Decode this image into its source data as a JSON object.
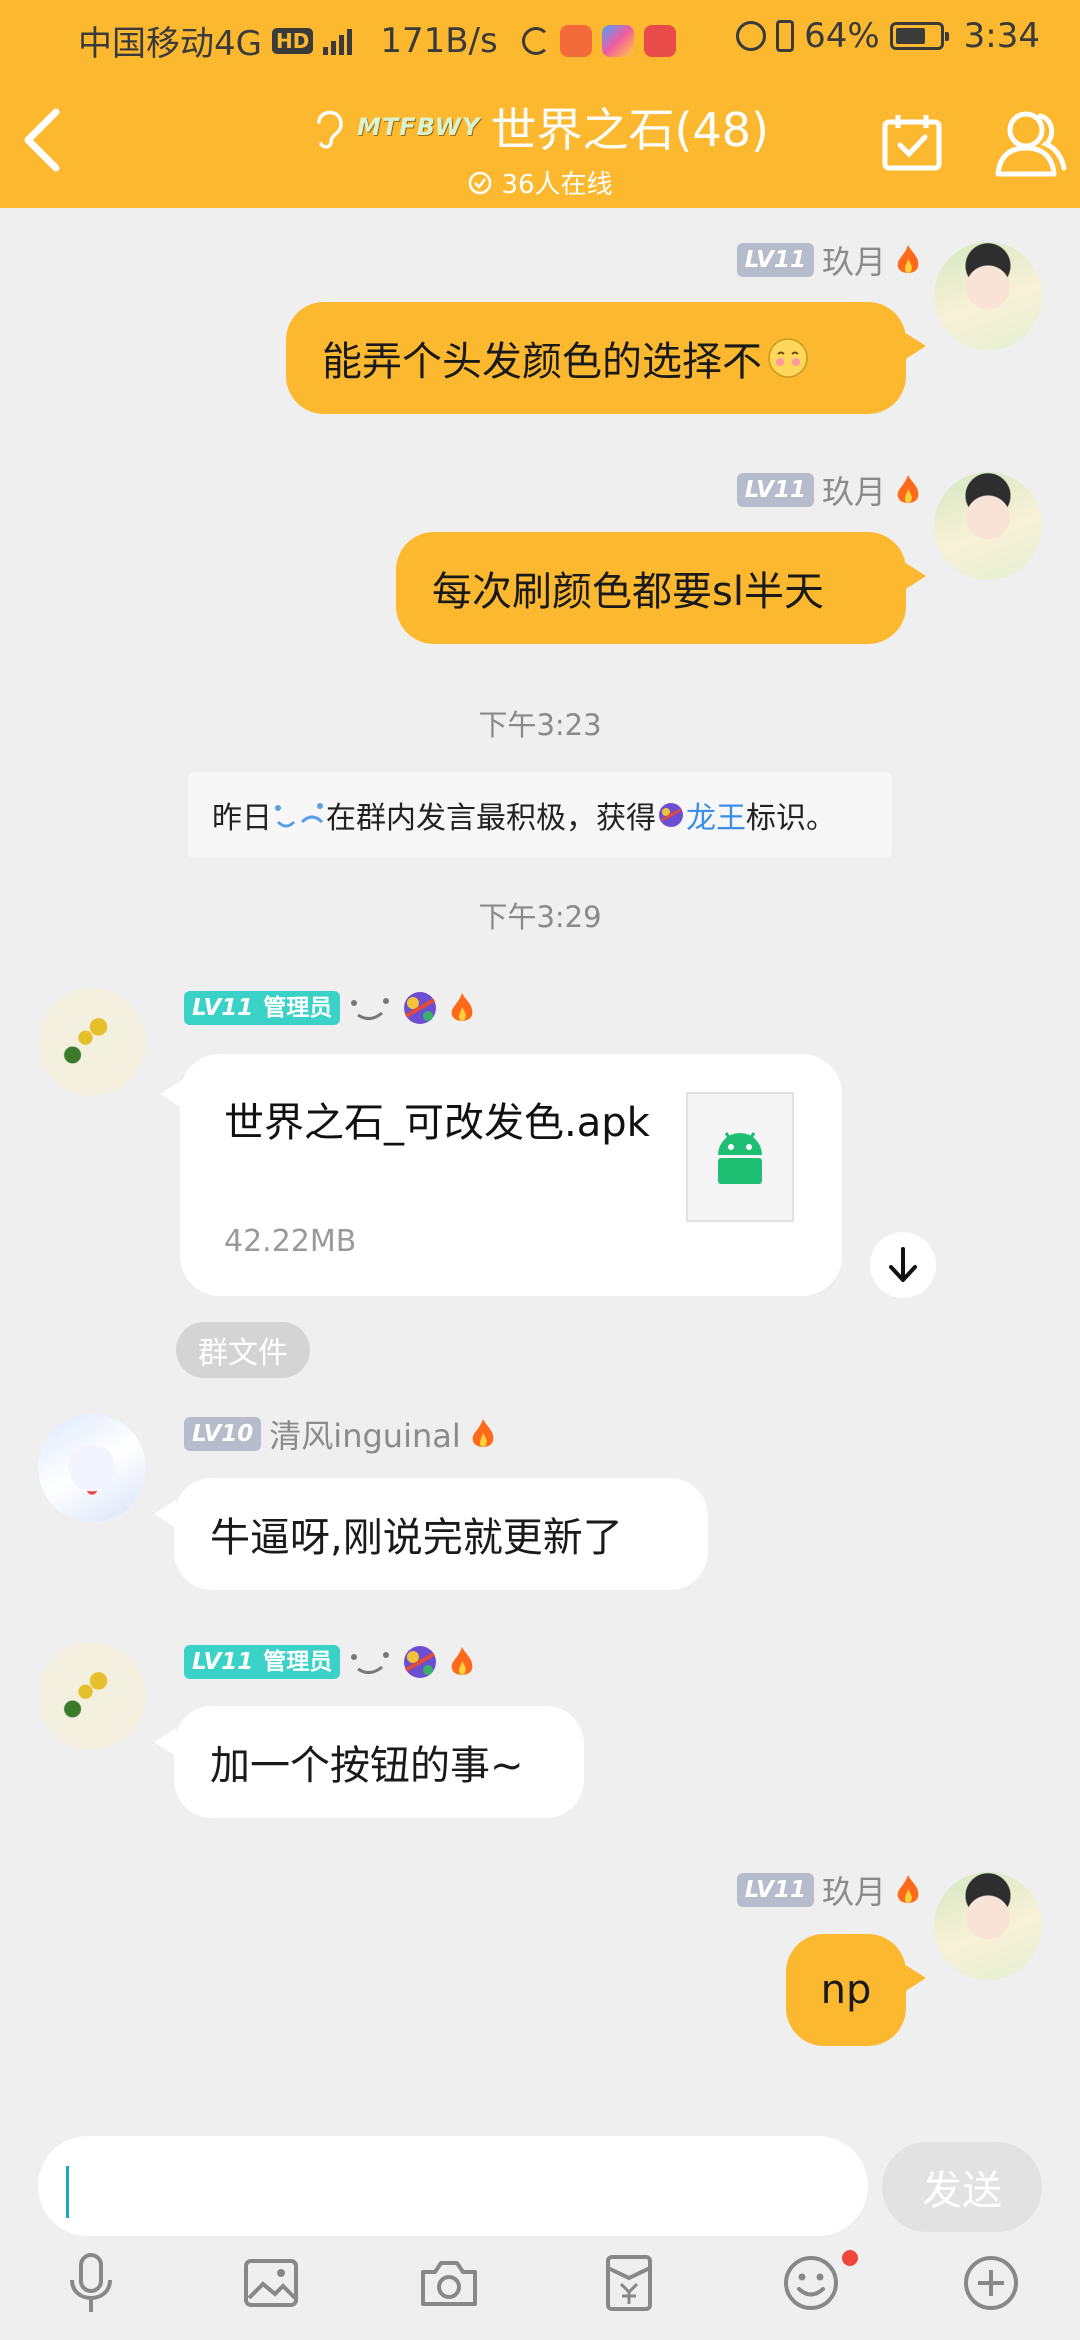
{
  "status_bar": {
    "carrier": "中国移动4G",
    "hd": "HD",
    "net_speed": "171B/s",
    "battery": "64%",
    "time": "3:34"
  },
  "header": {
    "brand": "MTFBWY",
    "title": "世界之石(48)",
    "online": "36人在线",
    "accent_color": "#fcb930"
  },
  "messages": {
    "m1": {
      "level": "LV11",
      "nick": "玖月",
      "text": "能弄个头发颜色的选择不"
    },
    "m2": {
      "level": "LV11",
      "nick": "玖月",
      "text": "每次刷颜色都要sl半天"
    },
    "time1": "下午3:23",
    "system": {
      "part1": "昨日",
      "part2": "在群内发言最积极，获得",
      "highlight": "龙王",
      "part3": "标识。"
    },
    "time2": "下午3:29",
    "m3": {
      "level": "LV11",
      "role": "管理员",
      "file_name": "世界之石_可改发色.apk",
      "file_size": "42.22MB",
      "tag": "群文件"
    },
    "m4": {
      "level": "LV10",
      "nick": "清风inguinal",
      "text": "牛逼呀,刚说完就更新了"
    },
    "m5": {
      "level": "LV11",
      "role": "管理员",
      "text": "加一个按钮的事~"
    },
    "m6": {
      "level": "LV11",
      "nick": "玖月",
      "text": "np"
    }
  },
  "composer": {
    "input_value": "",
    "send_label": "发送",
    "tools": [
      "mic-icon",
      "image-icon",
      "camera-icon",
      "red-packet-icon",
      "emoji-icon",
      "plus-icon"
    ]
  }
}
